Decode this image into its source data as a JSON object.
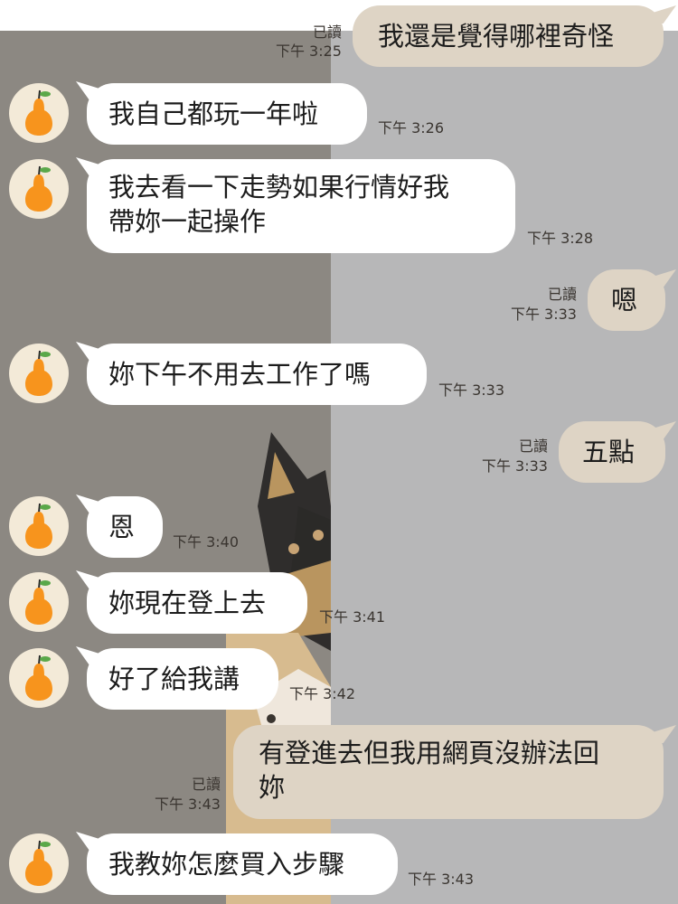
{
  "colors": {
    "incoming_bubble": "#ffffff",
    "outgoing_bubble": "#ded4c5",
    "avatar_bg": "#f3ead8",
    "pear": "#f7941d",
    "leaf": "#5aa84a"
  },
  "avatar_icon": "pear-icon",
  "messages": [
    {
      "direction": "out",
      "text": "我還是覺得哪裡奇怪",
      "read": "已讀",
      "time": "下午 3:25"
    },
    {
      "direction": "in",
      "text": "我自己都玩一年啦",
      "time": "下午 3:26"
    },
    {
      "direction": "in",
      "text_line1": "我去看一下走勢如果行情好我",
      "text_line2": "帶妳一起操作",
      "time": "下午 3:28"
    },
    {
      "direction": "out",
      "text": "嗯",
      "read": "已讀",
      "time": "下午 3:33"
    },
    {
      "direction": "in",
      "text": "妳下午不用去工作了嗎",
      "time": "下午 3:33"
    },
    {
      "direction": "out",
      "text": "五點",
      "read": "已讀",
      "time": "下午 3:33"
    },
    {
      "direction": "in",
      "text": "恩",
      "time": "下午 3:40"
    },
    {
      "direction": "in",
      "text": "妳現在登上去",
      "time": "下午 3:41"
    },
    {
      "direction": "in",
      "text": "好了給我講",
      "time": "下午 3:42"
    },
    {
      "direction": "out",
      "text_line1": "有登進去但我用網頁沒辦法回",
      "text_line2": "妳",
      "read": "已讀",
      "time": "下午 3:43"
    },
    {
      "direction": "in",
      "text": "我教妳怎麼買入步驟",
      "time": "下午 3:43"
    }
  ]
}
